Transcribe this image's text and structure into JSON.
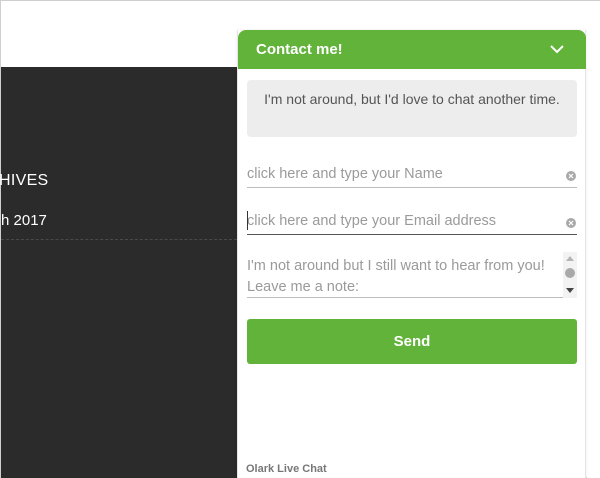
{
  "background": {
    "archives_heading": "HIVES",
    "archive_item": "h 2017",
    "dark_color": "#2b2b2b"
  },
  "chat": {
    "title": "Contact me!",
    "collapse_icon": "chevron-down-icon",
    "notice": "I'm not around, but I'd love to chat another time.",
    "name_placeholder": "click here and type your Name",
    "email_placeholder": "click here and type your Email address",
    "note_placeholder": "I'm not around but I still want to hear from you!  Leave me a note:",
    "send_label": "Send",
    "powered_by": "Olark Live Chat",
    "accent_color": "#62b33a"
  }
}
